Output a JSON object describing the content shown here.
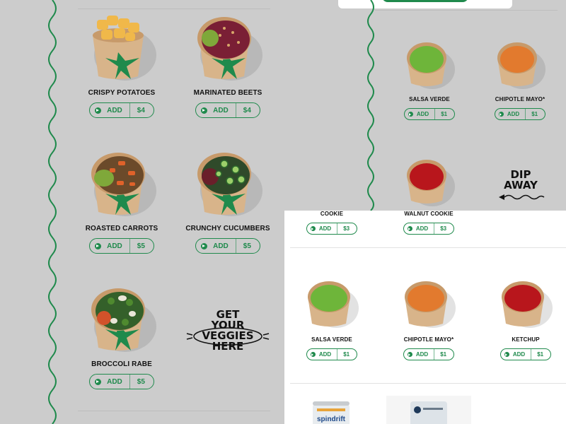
{
  "left_panel": {
    "items": [
      {
        "name": "CRISPY POTATOES",
        "add_label": "ADD",
        "price": "$4",
        "bowl": "potatoes"
      },
      {
        "name": "MARINATED BEETS",
        "add_label": "ADD",
        "price": "$4",
        "bowl": "beets"
      },
      {
        "name": "ROASTED CARROTS",
        "add_label": "ADD",
        "price": "$5",
        "bowl": "carrots"
      },
      {
        "name": "CRUNCHY CUCUMBERS",
        "add_label": "ADD",
        "price": "$5",
        "bowl": "cucumbers"
      },
      {
        "name": "BROCCOLI RABE",
        "add_label": "ADD",
        "price": "$5",
        "bowl": "broccoli"
      }
    ],
    "promo": {
      "line1": "GET",
      "line2": "YOUR",
      "line3": "VEGGIES",
      "line4": "HERE"
    }
  },
  "top_right_panel": {
    "items": [
      {
        "name": "SALSA VERDE",
        "add_label": "ADD",
        "price": "$1",
        "sauce": "green"
      },
      {
        "name": "CHIPOTLE MAYO*",
        "add_label": "ADD",
        "price": "$1",
        "sauce": "orange"
      },
      {
        "name": "",
        "add_label": "",
        "price": "",
        "sauce": "red"
      }
    ],
    "promo": {
      "line1": "DIP",
      "line2": "AWAY"
    }
  },
  "bottom_right_panel": {
    "cookies": [
      {
        "name": "COOKIE",
        "add_label": "ADD",
        "price": "$3"
      },
      {
        "name": "WALNUT COOKIE",
        "add_label": "ADD",
        "price": "$3"
      }
    ],
    "sauces": [
      {
        "name": "SALSA VERDE",
        "add_label": "ADD",
        "price": "$1",
        "sauce": "green"
      },
      {
        "name": "CHIPOTLE MAYO*",
        "add_label": "ADD",
        "price": "$1",
        "sauce": "orange"
      },
      {
        "name": "KETCHUP",
        "add_label": "ADD",
        "price": "$1",
        "sauce": "red"
      }
    ],
    "drinks": [
      {
        "brand": "spindrift"
      },
      {
        "brand": ""
      }
    ]
  },
  "colors": {
    "accent": "#1f8a4c",
    "panel_gray": "#cccccc",
    "bowl_kraft": "#d8b48a"
  }
}
